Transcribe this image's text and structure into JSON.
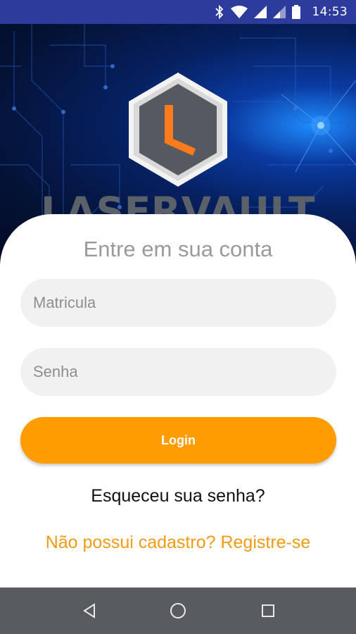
{
  "status_bar": {
    "time": "14:53",
    "icons": [
      "bluetooth-icon",
      "wifi-icon",
      "signal-icon",
      "signal-icon",
      "battery-icon"
    ]
  },
  "hero": {
    "brand_name": "LASERVAULT",
    "logo_icon": "laservault-hexagon-logo",
    "colors": {
      "background": "#041235",
      "glow": "#1f8cff",
      "logo_accent": "#ff7a1a"
    }
  },
  "login_form": {
    "title": "Entre em sua conta",
    "matricula_placeholder": "Matricula",
    "senha_placeholder": "Senha",
    "login_label": "Login",
    "forgot_label": "Esqueceu sua senha?",
    "register_label": "Não possui cadastro? Registre-se",
    "colors": {
      "button": "#ff9c00",
      "link": "#f39a14",
      "field": "#f1f1f1"
    }
  },
  "nav_bar": {
    "icons": [
      "back-icon",
      "home-icon",
      "recents-icon"
    ]
  }
}
